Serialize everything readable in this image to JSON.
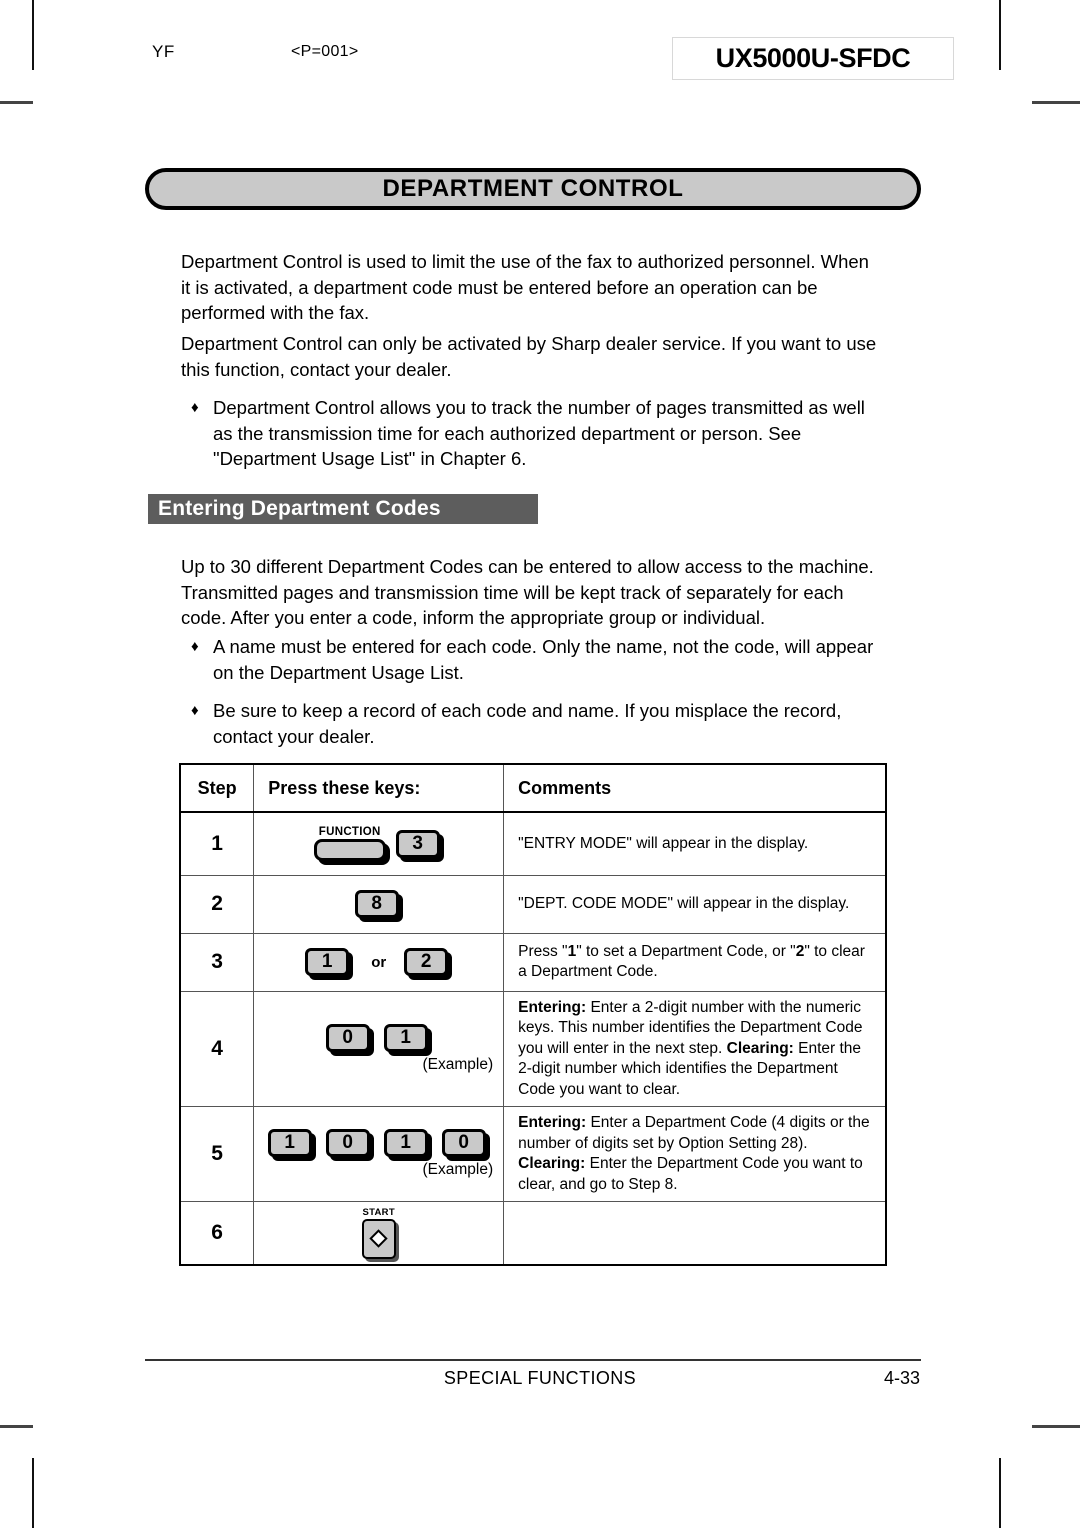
{
  "slug": {
    "left_code": "YF",
    "page_code": "<P=001>",
    "model": "UX5000U-SFDC"
  },
  "banner": {
    "title": "DEPARTMENT CONTROL"
  },
  "intro": {
    "paragraph_1": "Department Control is used to limit the use of the fax to authorized personnel. When it is activated, a department code must be entered before an operation can be performed with the fax.",
    "paragraph_2": "Department Control can only be activated by Sharp dealer service. If you want to use this function, contact your dealer.",
    "bullet_1_marker": "♦",
    "bullet_1": "Department Control allows you to track the number of pages transmitted as well as the transmission time for each authorized department or person. See \"Department Usage List\" in Chapter 6."
  },
  "section": {
    "heading": "Entering Department Codes",
    "paragraph_1": "Up to 30 different Department Codes can be entered to allow access to the machine. Transmitted pages and transmission time will be kept track of separately for each code. After you enter a code, inform the appropriate group or individual.",
    "bullet_1_marker": "♦",
    "bullet_1": "A name must be entered for each code. Only the name, not the code, will appear on the Department Usage List.",
    "bullet_2_marker": "♦",
    "bullet_2": "Be sure to keep a record of each code and name. If you misplace the record, contact your dealer."
  },
  "table": {
    "headers": {
      "step": "Step",
      "keys": "Press these keys:",
      "comments": "Comments"
    },
    "rows": [
      {
        "step": "1",
        "keys": [
          {
            "type": "function-key",
            "label": "FUNCTION"
          },
          {
            "type": "num-key",
            "label": "3"
          }
        ],
        "example": "",
        "comment_plain": "\"ENTRY MODE\" will appear in the display."
      },
      {
        "step": "2",
        "keys": [
          {
            "type": "num-key",
            "label": "8"
          }
        ],
        "example": "",
        "comment_plain": "\"DEPT. CODE MODE\" will appear in the display."
      },
      {
        "step": "3",
        "keys": [
          {
            "type": "num-key",
            "label": "1"
          },
          {
            "type": "text",
            "label": "or"
          },
          {
            "type": "num-key",
            "label": "2"
          }
        ],
        "example": "",
        "comment_parts": [
          {
            "bold": false,
            "text": "Press \""
          },
          {
            "bold": true,
            "text": "1"
          },
          {
            "bold": false,
            "text": "\" to set a Department Code, or \""
          },
          {
            "bold": true,
            "text": "2"
          },
          {
            "bold": false,
            "text": "\" to clear a Department Code."
          }
        ]
      },
      {
        "step": "4",
        "keys": [
          {
            "type": "num-key",
            "label": "0"
          },
          {
            "type": "num-key",
            "label": "1"
          }
        ],
        "example": "(Example)",
        "comment_parts": [
          {
            "bold": true,
            "text": "Entering:"
          },
          {
            "bold": false,
            "text": " Enter a 2-digit number with the numeric keys. This number identifies the Department Code you will enter in the next step. "
          },
          {
            "bold": true,
            "text": "Clearing:"
          },
          {
            "bold": false,
            "text": " Enter the 2-digit number which identifies the Department Code you want to clear."
          }
        ]
      },
      {
        "step": "5",
        "keys": [
          {
            "type": "num-key",
            "label": "1"
          },
          {
            "type": "num-key",
            "label": "0"
          },
          {
            "type": "num-key",
            "label": "1"
          },
          {
            "type": "num-key",
            "label": "0"
          }
        ],
        "example": "(Example)",
        "comment_parts": [
          {
            "bold": true,
            "text": "Entering:"
          },
          {
            "bold": false,
            "text": " Enter a Department Code (4 digits or the number of digits set by Option Setting 28). "
          },
          {
            "bold": true,
            "text": "Clearing:"
          },
          {
            "bold": false,
            "text": " Enter the Department Code you want to clear, and go to Step 8."
          }
        ]
      },
      {
        "step": "6",
        "keys": [
          {
            "type": "start-key",
            "label": "START"
          }
        ],
        "example": "",
        "comment_plain": ""
      }
    ]
  },
  "footer": {
    "chapter": "SPECIAL FUNCTIONS",
    "page_number": "4-33"
  },
  "colors": {
    "banner_fill": "#c9c9c9",
    "section_bar": "#5d5d5d",
    "key_fill": "#c9c9c9",
    "ink": "#000000"
  }
}
